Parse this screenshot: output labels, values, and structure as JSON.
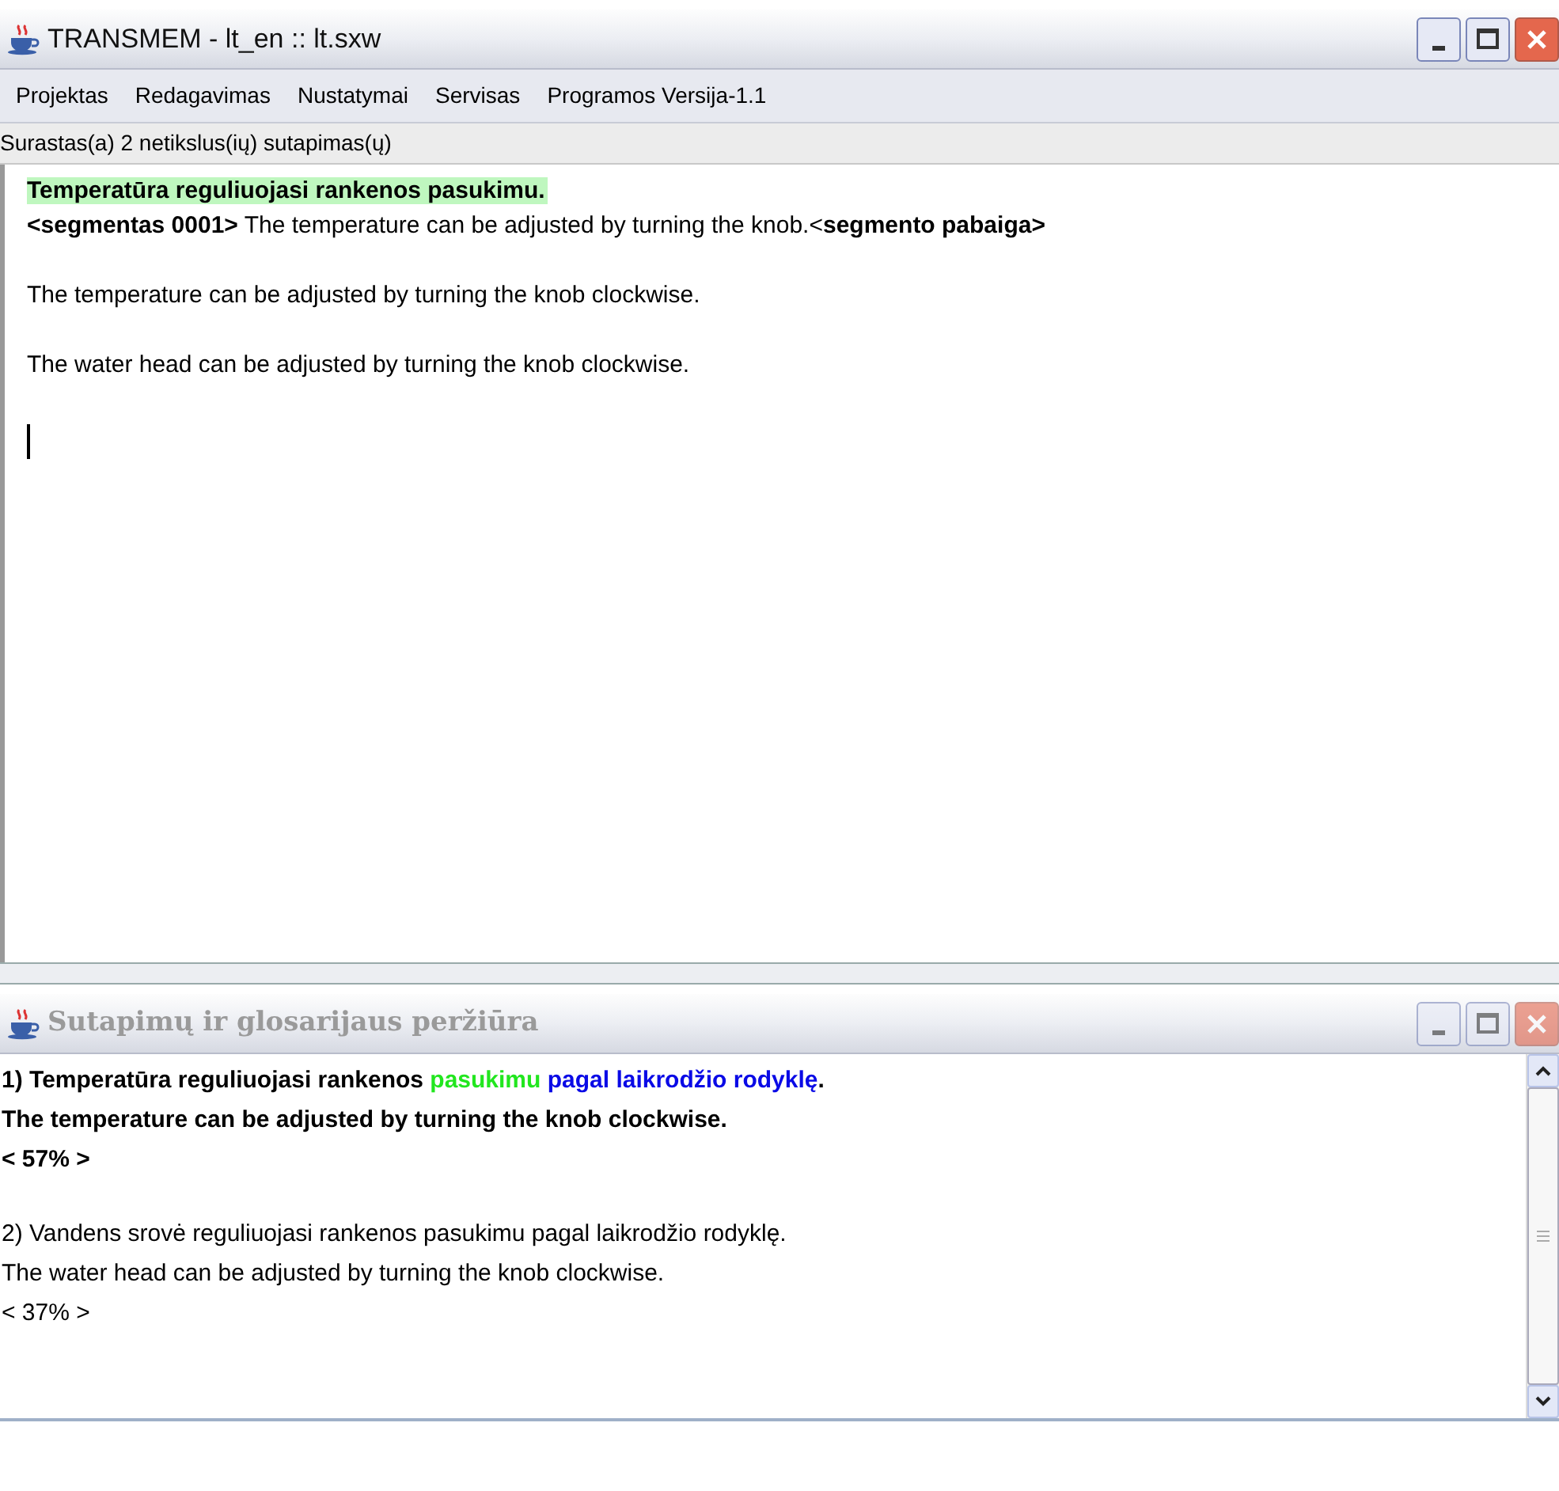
{
  "main_window": {
    "title": "TRANSMEM - lt_en :: lt.sxw",
    "active": true
  },
  "menu": [
    "Projektas",
    "Redagavimas",
    "Nustatymai",
    "Servisas",
    "Programos Versija-1.1"
  ],
  "status": "Surastas(a) 2 netikslus(ių) sutapimas(ų)",
  "editor": {
    "lines": [
      {
        "kind": "source",
        "text": "Temperatūra reguliuojasi rankenos pasukimu."
      },
      {
        "kind": "segment",
        "text": "**<segmentas 0001>** The temperature can be adjusted by turning the knob.<**segmento pabaiga>**"
      },
      {
        "kind": "blank"
      },
      {
        "kind": "plain",
        "text": "The temperature can be adjusted by turning the knob clockwise."
      },
      {
        "kind": "blank"
      },
      {
        "kind": "plain",
        "text": "The water head can be adjusted by turning the knob clockwise."
      },
      {
        "kind": "blank"
      },
      {
        "kind": "cursor"
      }
    ]
  },
  "matches_window": {
    "title": "Sutapimų ir glosarijaus peržiūra",
    "active": false,
    "matches": [
      {
        "selected": true,
        "number": "1)",
        "source": [
          {
            "text": "Temperatūra reguliuojasi rankenos "
          },
          {
            "text": "pasukimu",
            "color": "#22e61f"
          },
          {
            "text": " pagal laikrodžio rodyklę",
            "color": "#0a0ae6"
          },
          {
            "text": "."
          }
        ],
        "target": "The temperature can be adjusted by turning the knob clockwise.",
        "score": "< 57%  >"
      },
      {
        "selected": false,
        "number": "2)",
        "source": [
          {
            "text": "Vandens srovė reguliuojasi rankenos pasukimu pagal laikrodžio rodyklę."
          }
        ],
        "target": "The water head can be adjusted by turning the knob clockwise.",
        "score": "< 37%  >"
      }
    ]
  }
}
